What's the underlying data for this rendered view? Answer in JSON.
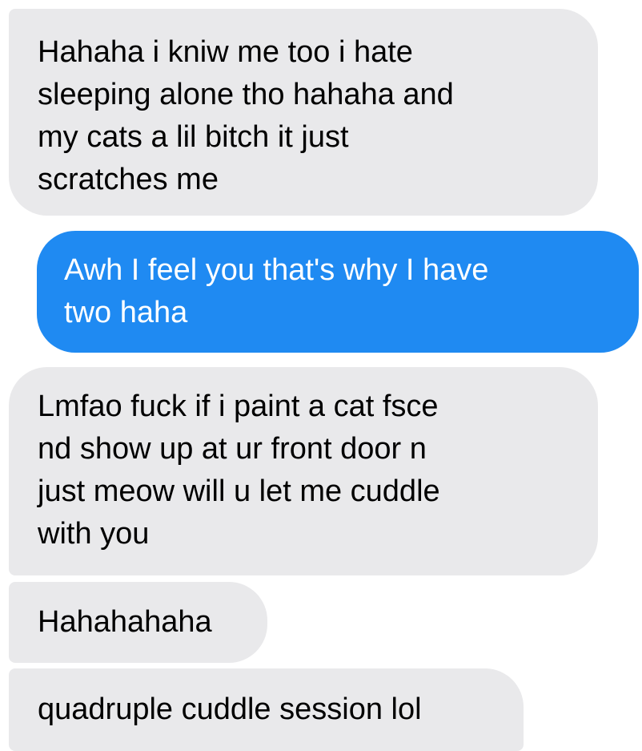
{
  "conversation": {
    "messages": [
      {
        "sender": "other",
        "text": "Hahaha  i kniw me too i hate\nsleeping alone tho hahaha and\nmy cats a lil bitch it just\nscratches me"
      },
      {
        "sender": "me",
        "text": "Awh I feel you that's why I have\ntwo haha"
      },
      {
        "sender": "other",
        "text": "Lmfao fuck if i paint a cat fsce\nnd show up at ur front door n\njust meow will u let me cuddle\nwith you"
      },
      {
        "sender": "other",
        "text": "Hahahahaha"
      },
      {
        "sender": "other",
        "text": "quadruple cuddle session lol"
      }
    ]
  },
  "colors": {
    "received_bubble": "#e9e9eb",
    "sent_bubble": "#1f8af2",
    "received_text": "#000000",
    "sent_text": "#ffffff",
    "background": "#ffffff"
  }
}
